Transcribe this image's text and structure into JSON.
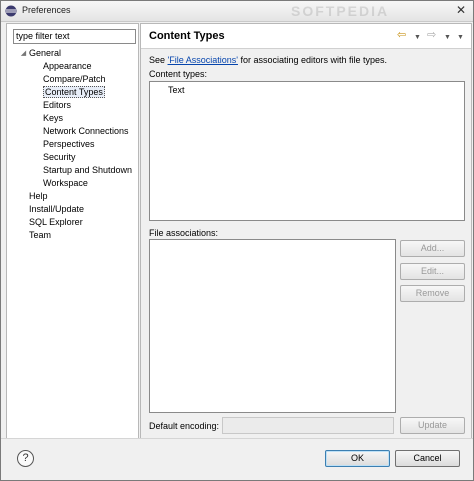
{
  "window": {
    "title": "Preferences",
    "watermark": "SOFTPEDIA",
    "close_glyph": "✕"
  },
  "filter": {
    "value": "type filter text"
  },
  "tree": [
    {
      "label": "General",
      "level": 0,
      "expanded": true
    },
    {
      "label": "Appearance",
      "level": 1
    },
    {
      "label": "Compare/Patch",
      "level": 1
    },
    {
      "label": "Content Types",
      "level": 1,
      "selected": true
    },
    {
      "label": "Editors",
      "level": 1
    },
    {
      "label": "Keys",
      "level": 1
    },
    {
      "label": "Network Connections",
      "level": 1
    },
    {
      "label": "Perspectives",
      "level": 1
    },
    {
      "label": "Security",
      "level": 1
    },
    {
      "label": "Startup and Shutdown",
      "level": 1
    },
    {
      "label": "Workspace",
      "level": 1
    },
    {
      "label": "Help",
      "level": 0
    },
    {
      "label": "Install/Update",
      "level": 0
    },
    {
      "label": "SQL Explorer",
      "level": 0
    },
    {
      "label": "Team",
      "level": 0
    }
  ],
  "page": {
    "title": "Content Types",
    "desc_prefix": "See ",
    "desc_link": "'File Associations'",
    "desc_suffix": " for associating editors with file types.",
    "content_types_label": "Content types:",
    "content_types": [
      "Text"
    ],
    "file_assoc_label": "File associations:",
    "encoding_label": "Default encoding:",
    "buttons": {
      "add": "Add...",
      "edit": "Edit...",
      "remove": "Remove",
      "update": "Update"
    }
  },
  "footer": {
    "help": "?",
    "ok": "OK",
    "cancel": "Cancel"
  },
  "icons": {
    "back": "back-arrow-icon",
    "forward": "forward-arrow-icon",
    "menu": "dropdown-icon",
    "help": "help-icon",
    "app": "eclipse-icon"
  },
  "colors": {
    "link": "#0645ad",
    "back_arrow": "#c8941a"
  }
}
